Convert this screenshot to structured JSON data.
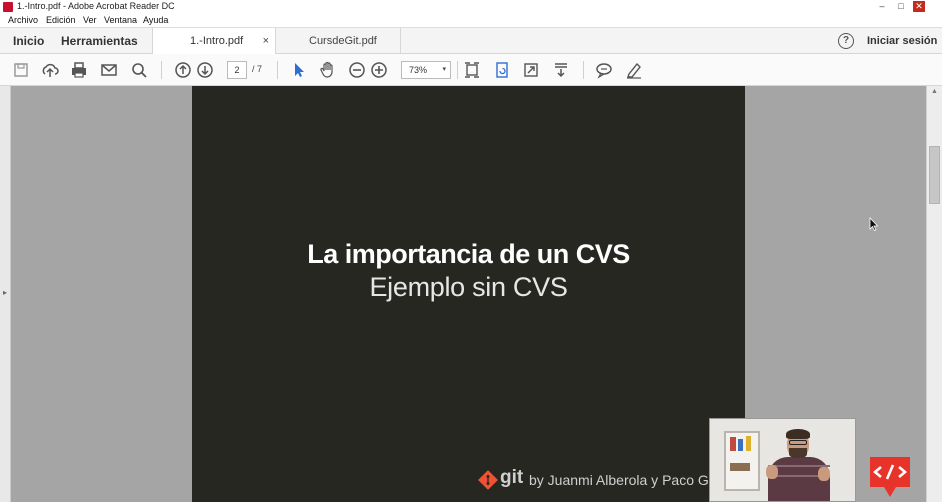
{
  "window": {
    "title": "1.-Intro.pdf - Adobe Acrobat Reader DC",
    "minimize": "–",
    "maximize": "□",
    "close": "✕"
  },
  "menu": {
    "items": [
      "Archivo",
      "Edición",
      "Ver",
      "Ventana",
      "Ayuda"
    ]
  },
  "tabs": {
    "home": "Inicio",
    "tools": "Herramientas",
    "documents": [
      {
        "label": "1.-Intro.pdf",
        "close": "×"
      },
      {
        "label": "CursdeGit.pdf"
      }
    ],
    "help_symbol": "?",
    "signin": "Iniciar sesión"
  },
  "toolbar": {
    "icons": [
      "save-icon",
      "upload-cloud-icon",
      "print-icon",
      "mail-icon",
      "search-icon",
      "page-up-icon",
      "page-down-icon",
      "select-pointer-icon",
      "hand-icon",
      "zoom-out-icon",
      "zoom-in-icon",
      "fit-page-icon",
      "rotate-page-icon",
      "full-screen-icon",
      "scroll-mode-icon",
      "comment-icon",
      "highlight-pen-icon"
    ],
    "page_current": "2",
    "page_total": "/ 7",
    "zoom": "73%",
    "zoom_arrow": "▾"
  },
  "slide": {
    "title": "La importancia de un CVS",
    "subtitle": "Ejemplo sin CVS",
    "logo_word": "git",
    "author": "by Juanmi Alberola y Paco Gó"
  },
  "colors": {
    "slide_bg": "#272722",
    "doc_bg": "#a5a5a5",
    "git_orange": "#f05133",
    "badge_red": "#e8332a",
    "select_blue": "#2d6ed6"
  },
  "scroll_position": 0.15
}
